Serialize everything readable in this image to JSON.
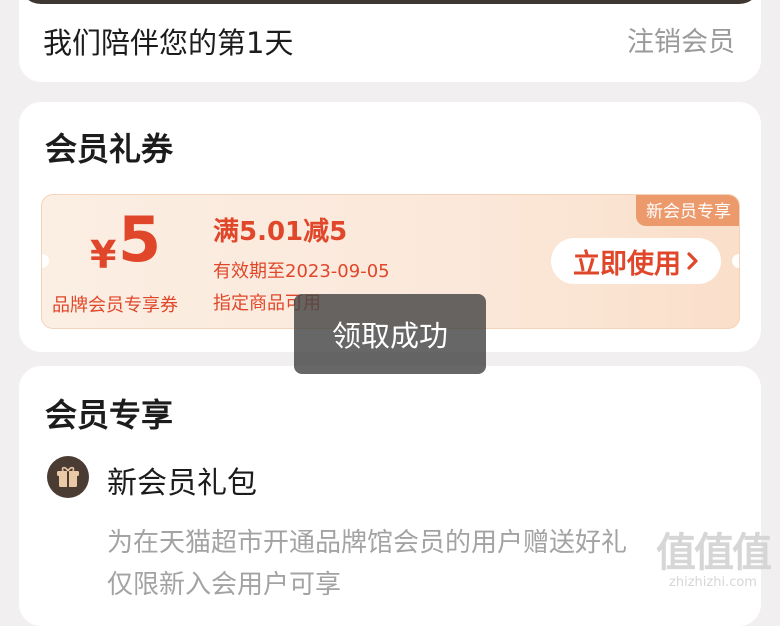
{
  "top_card": {
    "days_text": "我们陪伴您的第1天",
    "cancel_label": "注销会员"
  },
  "coupons": {
    "title": "会员礼券",
    "coupon": {
      "currency": "¥",
      "amount": "5",
      "type": "品牌会员专享券",
      "condition": "满5.01减5",
      "validity": "有效期至2023-09-05",
      "scope": "指定商品可用",
      "tag": "新会员专享",
      "button_label": "立即使用"
    }
  },
  "exclusive": {
    "title": "会员专享",
    "gift": {
      "icon": "gift-icon",
      "title": "新会员礼包",
      "desc_line1": "为在天猫超市开通品牌馆会员的用户赠送好礼",
      "desc_line2": "仅限新入会用户可享"
    }
  },
  "toast": {
    "message": "领取成功"
  },
  "watermark": {
    "logo": "值值值",
    "url": "zhizhizhi.com"
  },
  "colors": {
    "accent": "#e0472a",
    "tag": "#ec9a6c",
    "page_bg": "#f1efef",
    "dark": "#3e3731"
  }
}
